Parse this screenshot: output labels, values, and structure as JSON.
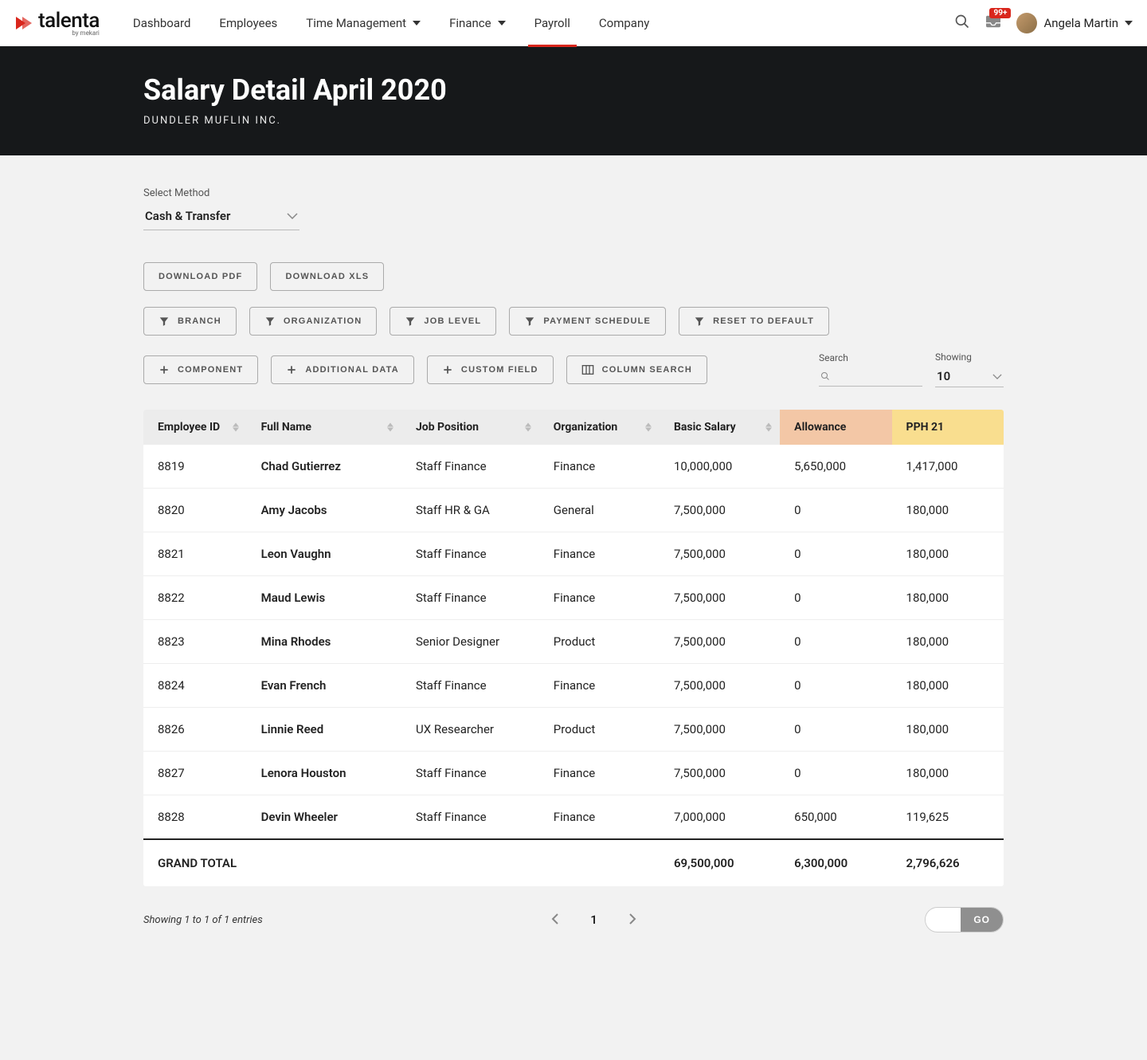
{
  "logo": {
    "text": "talenta",
    "sub": "by mekari"
  },
  "nav": {
    "dashboard": "Dashboard",
    "employees": "Employees",
    "time_management": "Time Management",
    "finance": "Finance",
    "payroll": "Payroll",
    "company": "Company"
  },
  "topbar": {
    "badge": "99+",
    "user_name": "Angela Martin"
  },
  "hero": {
    "title": "Salary Detail April 2020",
    "subtitle": "DUNDLER MUFLIN INC."
  },
  "method": {
    "label": "Select Method",
    "value": "Cash & Transfer"
  },
  "downloads": {
    "pdf": "DOWNLOAD PDF",
    "xls": "DOWNLOAD XLS"
  },
  "filters": {
    "branch": "BRANCH",
    "organization": "ORGANIZATION",
    "job_level": "JOB LEVEL",
    "payment_schedule": "PAYMENT SCHEDULE",
    "reset": "RESET TO DEFAULT"
  },
  "actions": {
    "component": "COMPONENT",
    "additional_data": "ADDITIONAL DATA",
    "custom_field": "CUSTOM FIELD",
    "column_search": "COLUMN SEARCH"
  },
  "search": {
    "label": "Search",
    "value": ""
  },
  "showing": {
    "label": "Showing",
    "value": "10"
  },
  "table": {
    "headers": {
      "employee_id": "Employee ID",
      "full_name": "Full Name",
      "job_position": "Job Position",
      "organization": "Organization",
      "basic_salary": "Basic Salary",
      "allowance": "Allowance",
      "pph21": "PPH 21"
    },
    "rows": [
      {
        "id": "8819",
        "name": "Chad Gutierrez",
        "position": "Staff Finance",
        "org": "Finance",
        "basic": "10,000,000",
        "allowance": "5,650,000",
        "pph": "1,417,000"
      },
      {
        "id": "8820",
        "name": "Amy Jacobs",
        "position": "Staff HR & GA",
        "org": "General",
        "basic": "7,500,000",
        "allowance": "0",
        "pph": "180,000"
      },
      {
        "id": "8821",
        "name": "Leon Vaughn",
        "position": "Staff Finance",
        "org": "Finance",
        "basic": "7,500,000",
        "allowance": "0",
        "pph": "180,000"
      },
      {
        "id": "8822",
        "name": "Maud Lewis",
        "position": "Staff Finance",
        "org": "Finance",
        "basic": "7,500,000",
        "allowance": "0",
        "pph": "180,000"
      },
      {
        "id": "8823",
        "name": "Mina Rhodes",
        "position": "Senior Designer",
        "org": "Product",
        "basic": "7,500,000",
        "allowance": "0",
        "pph": "180,000"
      },
      {
        "id": "8824",
        "name": "Evan French",
        "position": "Staff Finance",
        "org": "Finance",
        "basic": "7,500,000",
        "allowance": "0",
        "pph": "180,000"
      },
      {
        "id": "8826",
        "name": "Linnie Reed",
        "position": "UX Researcher",
        "org": "Product",
        "basic": "7,500,000",
        "allowance": "0",
        "pph": "180,000"
      },
      {
        "id": "8827",
        "name": "Lenora Houston",
        "position": "Staff Finance",
        "org": "Finance",
        "basic": "7,500,000",
        "allowance": "0",
        "pph": "180,000"
      },
      {
        "id": "8828",
        "name": "Devin Wheeler",
        "position": "Staff Finance",
        "org": "Finance",
        "basic": "7,000,000",
        "allowance": "650,000",
        "pph": "119,625"
      }
    ],
    "grand_total": {
      "label": "GRAND TOTAL",
      "basic": "69,500,000",
      "allowance": "6,300,000",
      "pph": "2,796,626"
    }
  },
  "pagination": {
    "info": "Showing 1 to 1 of 1 entries",
    "current": "1",
    "go_label": "GO"
  }
}
